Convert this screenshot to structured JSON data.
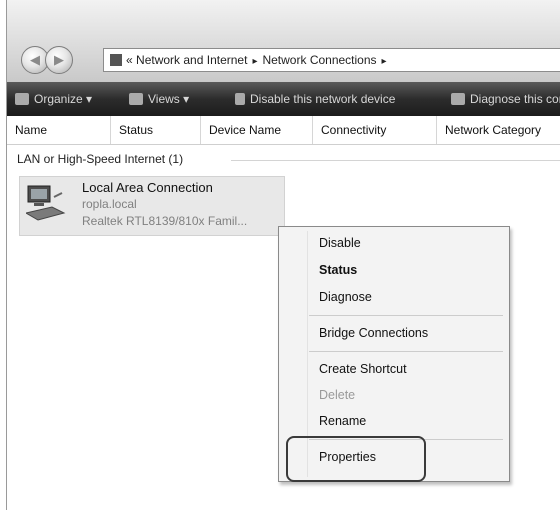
{
  "address_bar": {
    "back_arrow": "«",
    "crumbs": [
      "Network and Internet",
      "Network Connections"
    ],
    "separator": "▸"
  },
  "toolbar": {
    "items": [
      "Organize",
      "Views",
      "Disable this network device",
      "Diagnose this connection"
    ],
    "dropdown_glyph": "▾"
  },
  "columns": [
    "Name",
    "Status",
    "Device Name",
    "Connectivity",
    "Network Category"
  ],
  "group": {
    "label": "LAN or High-Speed Internet (1)"
  },
  "connection": {
    "name": "Local Area Connection",
    "network": "ropla.local",
    "device": "Realtek RTL8139/810x Famil..."
  },
  "context_menu": {
    "items": [
      {
        "label": "Disable",
        "style": "normal"
      },
      {
        "label": "Status",
        "style": "bold"
      },
      {
        "label": "Diagnose",
        "style": "normal"
      },
      {
        "label": "Bridge Connections",
        "style": "normal"
      },
      {
        "label": "Create Shortcut",
        "style": "normal"
      },
      {
        "label": "Delete",
        "style": "disabled"
      },
      {
        "label": "Rename",
        "style": "normal"
      },
      {
        "label": "Properties",
        "style": "normal",
        "highlighted": true
      }
    ]
  },
  "icons": {
    "network": "network-adapter-icon",
    "computer": "computer-icon",
    "organize": "organize-icon",
    "views": "views-icon",
    "disable": "disable-device-icon",
    "diagnose": "diagnose-icon"
  }
}
